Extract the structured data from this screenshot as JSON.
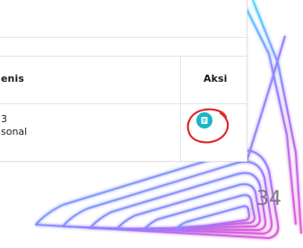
{
  "table": {
    "headers": {
      "jenis": "enis",
      "aksi": "Aksi"
    },
    "rows": [
      {
        "jenis_line1": "3",
        "jenis_line2": "sonal",
        "action_icon": "document-icon"
      }
    ]
  },
  "page_number": "34",
  "colors": {
    "action_button": "#19b6c8",
    "annotation_circle": "#e3262a",
    "decor_cyan": "#4fd8ff",
    "decor_magenta": "#e15bd6",
    "decor_purple": "#9a7bff"
  }
}
